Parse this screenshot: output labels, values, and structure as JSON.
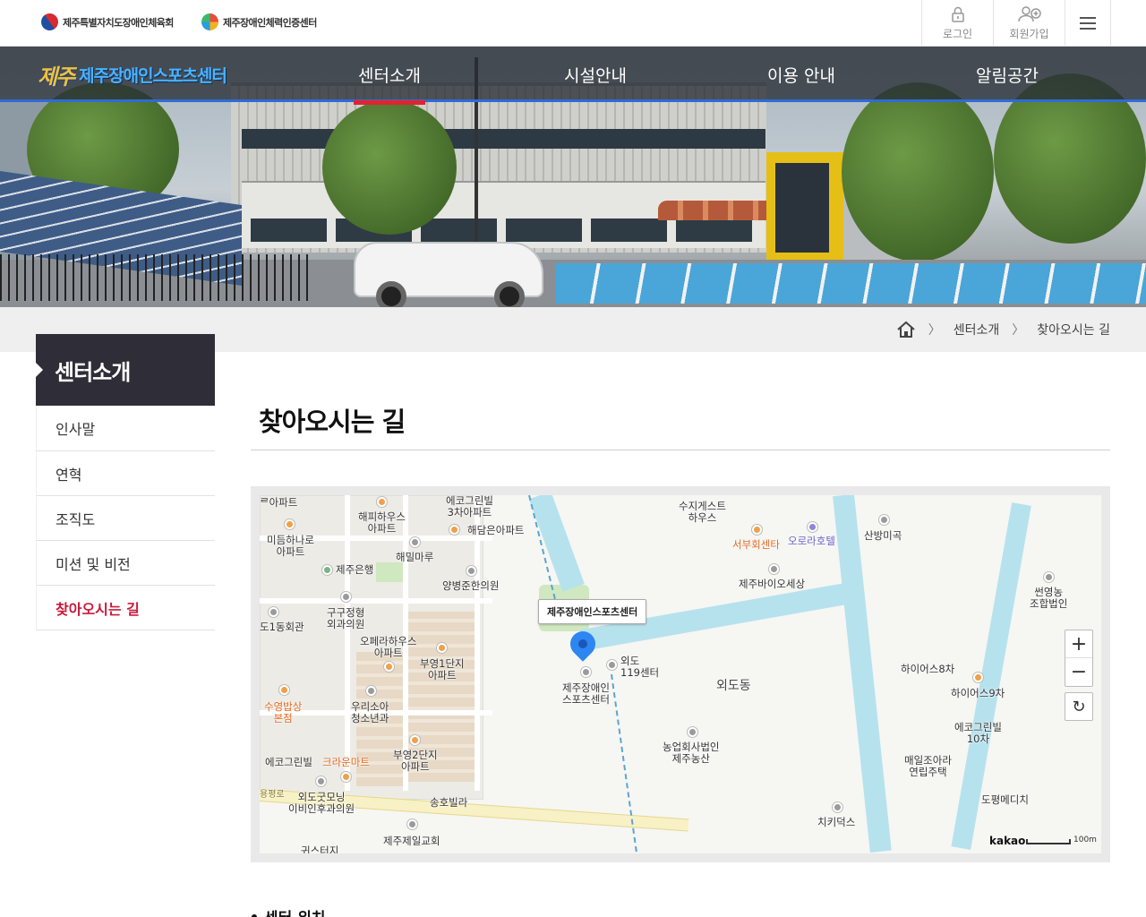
{
  "top": {
    "org1": "제주특별자치도장애인체육회",
    "org2": "제주장애인체력인증센터",
    "login": "로그인",
    "join": "회원가입"
  },
  "brand": {
    "mark": "제주",
    "name": "제주장애인스포츠센터"
  },
  "nav": [
    "센터소개",
    "시설안내",
    "이용 안내",
    "알림공간"
  ],
  "breadcrumb": [
    "센터소개",
    "찾아오시는 길"
  ],
  "sidebar": {
    "title": "센터소개",
    "items": [
      "인사말",
      "연혁",
      "조직도",
      "미션 및 비전",
      "찾아오시는 길"
    ]
  },
  "page": {
    "title": "찾아오시는 길",
    "section": "센터 위치"
  },
  "map": {
    "tooltip": "제주장애인스포츠센터",
    "target": "제주장애인\n스포츠센터",
    "labels": {
      "l01": "ᄅ아파트",
      "l02": "해피하우스\n아파트",
      "l03": "에코그린빌\n3차아파트",
      "l04": "해담은아파트",
      "l05": "미듬하나로\n아파트",
      "l06": "해밀마루",
      "l07": "제주은행",
      "l08": "양병준한의원",
      "l09": "구구정형\n외과의원",
      "l10": "도1동회관",
      "l11": "오페라하우스\n아파트",
      "l12": "부영1단지\n아파트",
      "l13": "외도\n119센터",
      "l14": "수영밥상\n본점",
      "l15": "우리소아\n청소년과",
      "l16": "부영2단지\n아파트",
      "l17": "에코그린빌",
      "l18": "크라운마트",
      "l19": "외도굿모닝\n이비인후과의원",
      "l20": "송호빌라",
      "l21": "제주제일교회",
      "l22": "귀스터지",
      "l23": "수지게스트\n하우스",
      "l24": "서부회센타",
      "l25": "오로라호텔",
      "l26": "산방미곡",
      "l27": "제주바이오세상",
      "l28": "썬영농\n조합법인",
      "l29": "외도동",
      "l30": "하이어스8차",
      "l31": "하이어스9차",
      "l32": "에코그린빌\n10차",
      "l33": "농업회사법인\n제주농산",
      "l34": "매일조아라\n연립주택",
      "l35": "도평메디치",
      "l36": "치키덕스",
      "l37": "용평로"
    },
    "zoom_in": "+",
    "zoom_out": "−",
    "refresh": "↻",
    "provider": "kakao",
    "scale": "100m"
  },
  "colors": {
    "accent_red": "#e2232f",
    "nav_underline_blue": "#2f6bd6",
    "sidebar_head": "#2f2e38",
    "current_item": "#c81a3a"
  },
  "icons": {
    "home": "home-icon",
    "login": "lock-icon",
    "join": "add-user-icon",
    "menu": "menu-icon"
  }
}
